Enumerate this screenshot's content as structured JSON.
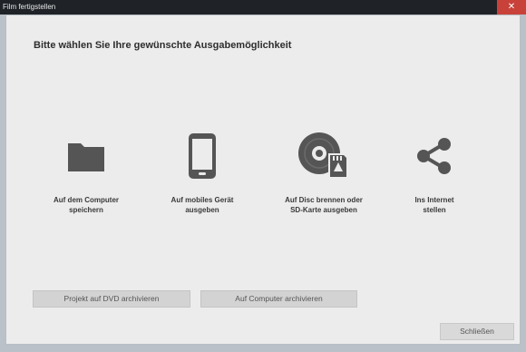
{
  "window": {
    "title": "Film fertigstellen",
    "close_symbol": "✕"
  },
  "dialog": {
    "heading": "Bitte wählen Sie Ihre gewünschte Ausgabemöglichkeit"
  },
  "options": [
    {
      "line1": "Auf dem Computer",
      "line2": "speichern",
      "icon": "folder-icon"
    },
    {
      "line1": "Auf mobiles Gerät",
      "line2": "ausgeben",
      "icon": "smartphone-icon"
    },
    {
      "line1": "Auf Disc brennen oder",
      "line2": "SD-Karte ausgeben",
      "icon": "disc-sdcard-icon"
    },
    {
      "line1": "Ins Internet",
      "line2": "stellen",
      "icon": "share-icon"
    }
  ],
  "buttons": {
    "archive_dvd": "Projekt auf DVD archivieren",
    "archive_computer": "Auf Computer archivieren",
    "close": "Schließen"
  }
}
